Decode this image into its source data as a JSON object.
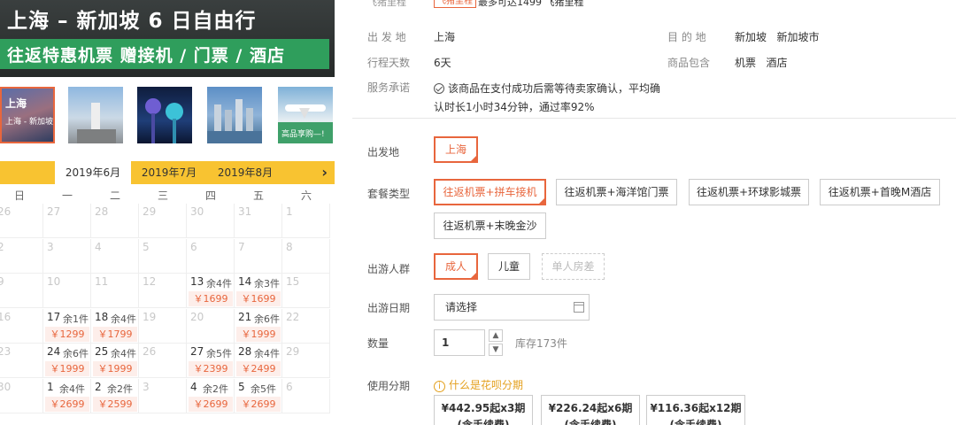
{
  "banner": {
    "title": "上海 – 新加坡 6 日自由行",
    "subtitle": "往返特惠机票 赠接机 / 门票 / 酒店"
  },
  "thumbnails": [
    {
      "caption": "上海",
      "mini": "上海 - 新加坡 6日自由行",
      "selected": true
    },
    {
      "caption": "",
      "mini": "",
      "selected": false
    },
    {
      "caption": "",
      "mini": "",
      "selected": false
    },
    {
      "caption": "",
      "mini": "",
      "selected": false
    },
    {
      "caption": "",
      "mini": "高品享购—!",
      "selected": false
    }
  ],
  "calendar": {
    "months": [
      "2019年6月",
      "2019年7月",
      "2019年8月"
    ],
    "selected_month_index": 0,
    "next_icon": "chevron-right-icon",
    "weekdays": [
      "日",
      "一",
      "二",
      "三",
      "四",
      "五",
      "六"
    ],
    "rows": [
      [
        {
          "d": "26",
          "m": true
        },
        {
          "d": "27",
          "m": true
        },
        {
          "d": "28",
          "m": true
        },
        {
          "d": "29",
          "m": true
        },
        {
          "d": "30",
          "m": true
        },
        {
          "d": "31",
          "m": true
        },
        {
          "d": "1",
          "m": true
        }
      ],
      [
        {
          "d": "2",
          "m": true
        },
        {
          "d": "3",
          "m": true
        },
        {
          "d": "4",
          "m": true
        },
        {
          "d": "5",
          "m": true
        },
        {
          "d": "6",
          "m": true
        },
        {
          "d": "7",
          "m": true
        },
        {
          "d": "8",
          "m": true
        }
      ],
      [
        {
          "d": "9",
          "m": true
        },
        {
          "d": "10",
          "m": true
        },
        {
          "d": "11",
          "m": true
        },
        {
          "d": "12",
          "m": true
        },
        {
          "d": "13",
          "s": "余4件",
          "p": "￥1699"
        },
        {
          "d": "14",
          "s": "余3件",
          "p": "￥1699"
        },
        {
          "d": "15",
          "m": true
        }
      ],
      [
        {
          "d": "16",
          "m": true
        },
        {
          "d": "17",
          "s": "余1件",
          "p": "￥1299"
        },
        {
          "d": "18",
          "s": "余4件",
          "p": "￥1799"
        },
        {
          "d": "19",
          "m": true
        },
        {
          "d": "20",
          "m": true
        },
        {
          "d": "21",
          "s": "余6件",
          "p": "￥1999"
        },
        {
          "d": "22",
          "m": true
        }
      ],
      [
        {
          "d": "23",
          "m": true
        },
        {
          "d": "24",
          "s": "余6件",
          "p": "￥1999"
        },
        {
          "d": "25",
          "s": "余4件",
          "p": "￥1999"
        },
        {
          "d": "26",
          "m": true
        },
        {
          "d": "27",
          "s": "余5件",
          "p": "￥2399"
        },
        {
          "d": "28",
          "s": "余4件",
          "p": "￥2499"
        },
        {
          "d": "29",
          "m": true
        }
      ],
      [
        {
          "d": "30",
          "m": true
        },
        {
          "d": "1",
          "s": "余4件",
          "p": "￥2699"
        },
        {
          "d": "2",
          "s": "余2件",
          "p": "￥2599"
        },
        {
          "d": "3",
          "m": true
        },
        {
          "d": "4",
          "s": "余2件",
          "p": "￥2699"
        },
        {
          "d": "5",
          "s": "余5件",
          "p": "￥2699"
        },
        {
          "d": "6",
          "m": true
        }
      ]
    ]
  },
  "top": {
    "label": "飞猪里程",
    "tag": "飞猪里程",
    "text": "最多可达1499 飞猪里程"
  },
  "info": {
    "depart_label": "出 发 地",
    "depart_value": "上海",
    "dest_label": "目 的 地",
    "dest_value": "新加坡   新加坡市",
    "days_label": "行程天数",
    "days_value": "6天",
    "includes_label": "商品包含",
    "includes_value": "机票   酒店",
    "promise_label": "服务承诺",
    "promise_text": "该商品在支付成功后需等待卖家确认，平均确认时长1小时34分钟，通过率92%"
  },
  "form": {
    "origin_label": "出发地",
    "origin_option": "上海",
    "package_label": "套餐类型",
    "packages": [
      "往返机票+拼车接机",
      "往返机票+海洋馆门票",
      "往返机票+环球影城票",
      "往返机票+首晚M酒店",
      "往返机票+末晚金沙"
    ],
    "group_label": "出游人群",
    "groups": [
      "成人",
      "儿童",
      "单人房差"
    ],
    "date_label": "出游日期",
    "date_placeholder": "请选择",
    "qty_label": "数量",
    "qty_value": "1",
    "stock_text": "库存173件",
    "installment_label": "使用分期",
    "huabei_text": "什么是花呗分期",
    "installments": [
      {
        "amount": "¥442.95起x3期",
        "fee": "(含手续费)"
      },
      {
        "amount": "¥226.24起x6期",
        "fee": "(含手续费)"
      },
      {
        "amount": "¥116.36起x12期",
        "fee": "(含手续费)"
      }
    ]
  },
  "colors": {
    "accent": "#e8663d",
    "calendar_bar": "#f8c331",
    "banner_green": "#2f9e5c"
  }
}
